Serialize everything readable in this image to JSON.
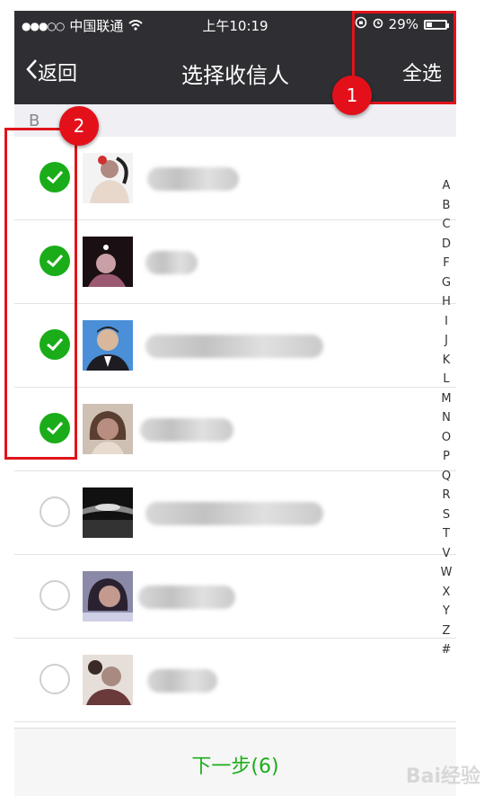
{
  "status_bar": {
    "signal_dots": "●●●○○",
    "carrier": "中国联通",
    "time": "上午10:19",
    "battery_text": "29%",
    "battery_level": 0.29
  },
  "nav": {
    "back_label": "返回",
    "title": "选择收信人",
    "select_all_label": "全选"
  },
  "section_header": "B",
  "contacts": [
    {
      "checked": true,
      "avatar": "avatar-girl-profile"
    },
    {
      "checked": true,
      "avatar": "avatar-dark-portrait"
    },
    {
      "checked": true,
      "avatar": "avatar-blue-id-photo"
    },
    {
      "checked": true,
      "avatar": "avatar-woman-portrait"
    },
    {
      "checked": false,
      "avatar": "avatar-night-landscape"
    },
    {
      "checked": false,
      "avatar": "avatar-selfie"
    },
    {
      "checked": false,
      "avatar": "avatar-couple-photo"
    }
  ],
  "alpha_index": [
    "A",
    "B",
    "C",
    "D",
    "F",
    "G",
    "H",
    "I",
    "J",
    "K",
    "L",
    "M",
    "N",
    "O",
    "P",
    "Q",
    "R",
    "S",
    "T",
    "V",
    "W",
    "X",
    "Y",
    "Z",
    "#"
  ],
  "bottom": {
    "next_label": "下一步(6)"
  },
  "annotations": {
    "badge_1": "1",
    "badge_2": "2"
  },
  "watermark": "Bai经验",
  "colors": {
    "nav_bg": "#2e2e33",
    "accent_green": "#1aad19",
    "annotation_red": "#e0141a"
  }
}
